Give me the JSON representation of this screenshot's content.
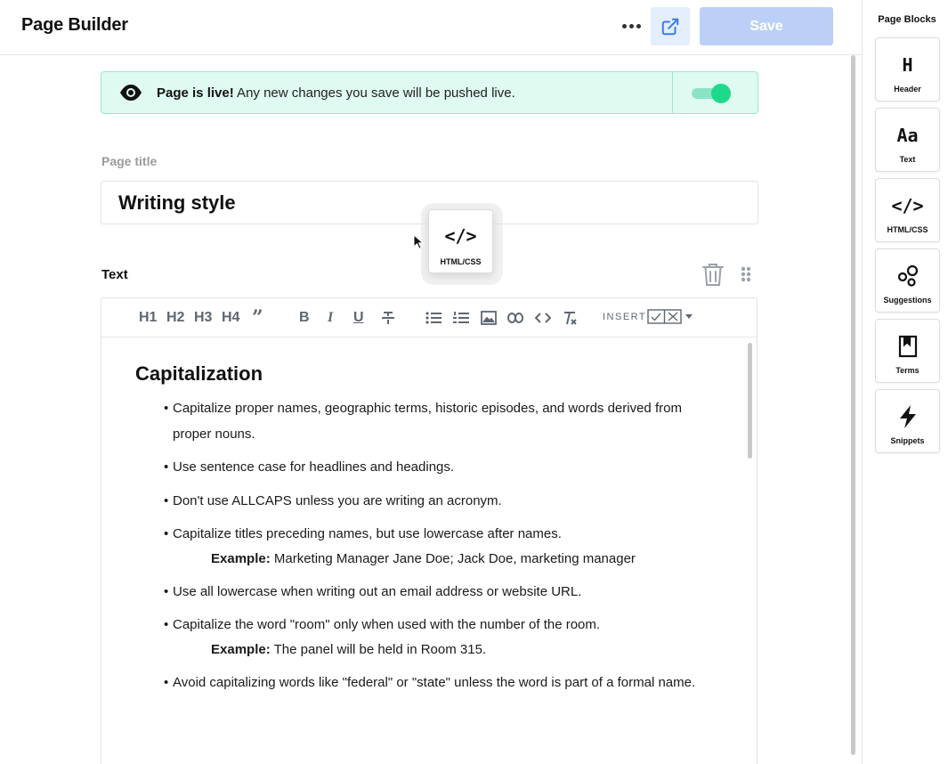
{
  "header": {
    "title": "Page Builder",
    "more_icon": "more-horizontal-icon",
    "open_icon": "external-link-icon",
    "save_label": "Save"
  },
  "banner": {
    "strong": "Page is live!",
    "message": " Any new changes you save will be pushed live.",
    "toggle_on": true,
    "icon": "eye-icon"
  },
  "page_title": {
    "label": "Page title",
    "value": "Writing style"
  },
  "text_block": {
    "label": "Text",
    "toolbar": {
      "h1": "H1",
      "h2": "H2",
      "h3": "H3",
      "h4": "H4",
      "insert_label": "INSERT"
    },
    "heading": "Capitalization",
    "items": [
      {
        "text": "Capitalize proper names, geographic terms, historic episodes, and words derived from proper nouns."
      },
      {
        "text": "Use sentence case for headlines and headings."
      },
      {
        "text": "Don't use ALLCAPS unless you are writing an acronym."
      },
      {
        "text": "Capitalize titles preceding names, but use lowercase after names.",
        "example_label": "Example:",
        "example_text": " Marketing Manager Jane Doe; Jack Doe, marketing manager"
      },
      {
        "text": "Use all lowercase when writing out an email address or website URL."
      },
      {
        "text": "Capitalize the word \"room\" only when used with the number of the room.",
        "example_label": "Example:",
        "example_text": " The panel will be held in Room 315."
      },
      {
        "text": "Avoid capitalizing words like \"federal\" or \"state\" unless the word is part of a formal name."
      }
    ]
  },
  "sidebar": {
    "title": "Page Blocks",
    "blocks": [
      {
        "label": "Header",
        "glyph": "H",
        "icon": "header-icon"
      },
      {
        "label": "Text",
        "glyph": "Aa",
        "icon": "text-icon"
      },
      {
        "label": "HTML/CSS",
        "glyph": "</>",
        "icon": "code-icon"
      },
      {
        "label": "Suggestions",
        "glyph": "",
        "icon": "suggestions-icon"
      },
      {
        "label": "Terms",
        "glyph": "",
        "icon": "bookmark-icon"
      },
      {
        "label": "Snippets",
        "glyph": "",
        "icon": "lightning-icon"
      }
    ]
  },
  "dragging": {
    "glyph": "</>",
    "label": "HTML/CSS"
  }
}
